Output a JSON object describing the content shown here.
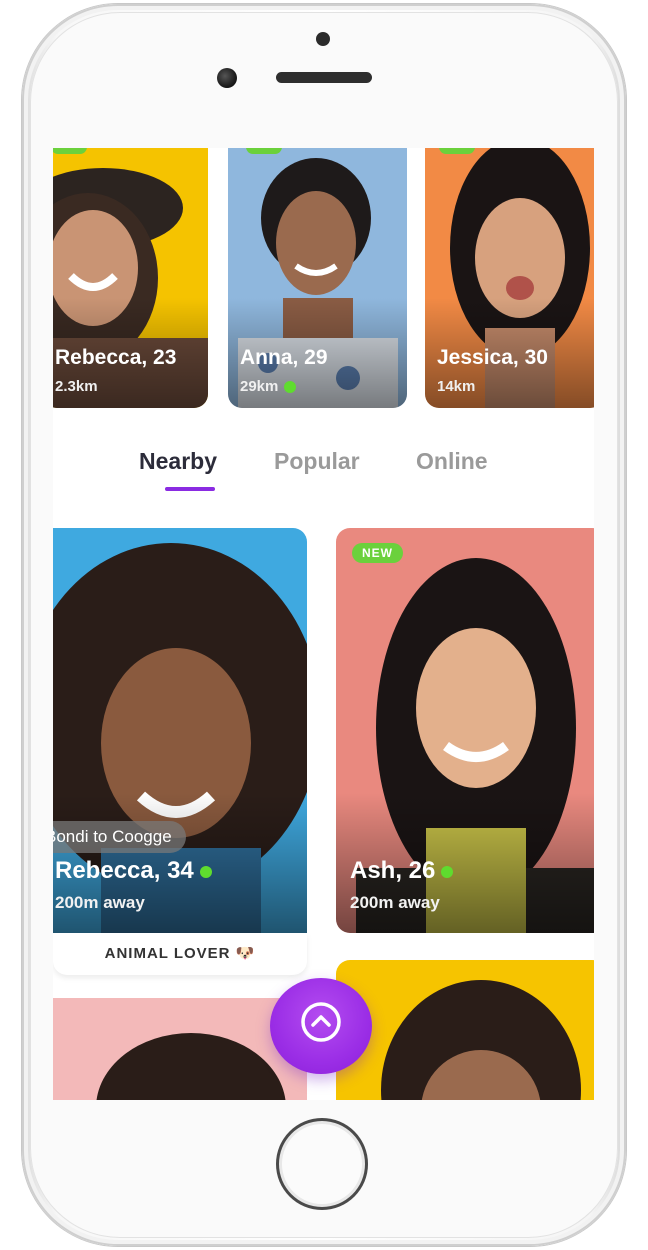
{
  "stories": [
    {
      "name": "Rebecca, 23",
      "distance": "2.3km",
      "online": false
    },
    {
      "name": "Anna, 29",
      "distance": "29km",
      "online": true
    },
    {
      "name": "Jessica, 30",
      "distance": "14km",
      "online": false
    }
  ],
  "tabs": [
    {
      "label": "Nearby",
      "active": true
    },
    {
      "label": "Popular",
      "active": false
    },
    {
      "label": "Online",
      "active": false
    }
  ],
  "cards": [
    {
      "name": "Rebecca, 34",
      "distance": "200m away",
      "location": "Bondi to Coogge",
      "online": true,
      "footer": "ANIMAL LOVER 🐶"
    },
    {
      "name": "Ash, 26",
      "distance": "200m away",
      "badge": "NEW",
      "online": true
    }
  ],
  "fab": {
    "icon": "chevron-up-circle-icon"
  },
  "colors": {
    "accent": "#8a2be2",
    "online": "#5fdc2e",
    "new_badge": "#6bd13c",
    "story_bg_1": "#f5c300",
    "story_bg_2": "#8fb7dd",
    "story_bg_3": "#f28a45",
    "card_bg_1": "#3fa9e0",
    "card_bg_2": "#e9897f",
    "card_bg_3": "#f3b9b9",
    "card_bg_4": "#f6c400"
  }
}
